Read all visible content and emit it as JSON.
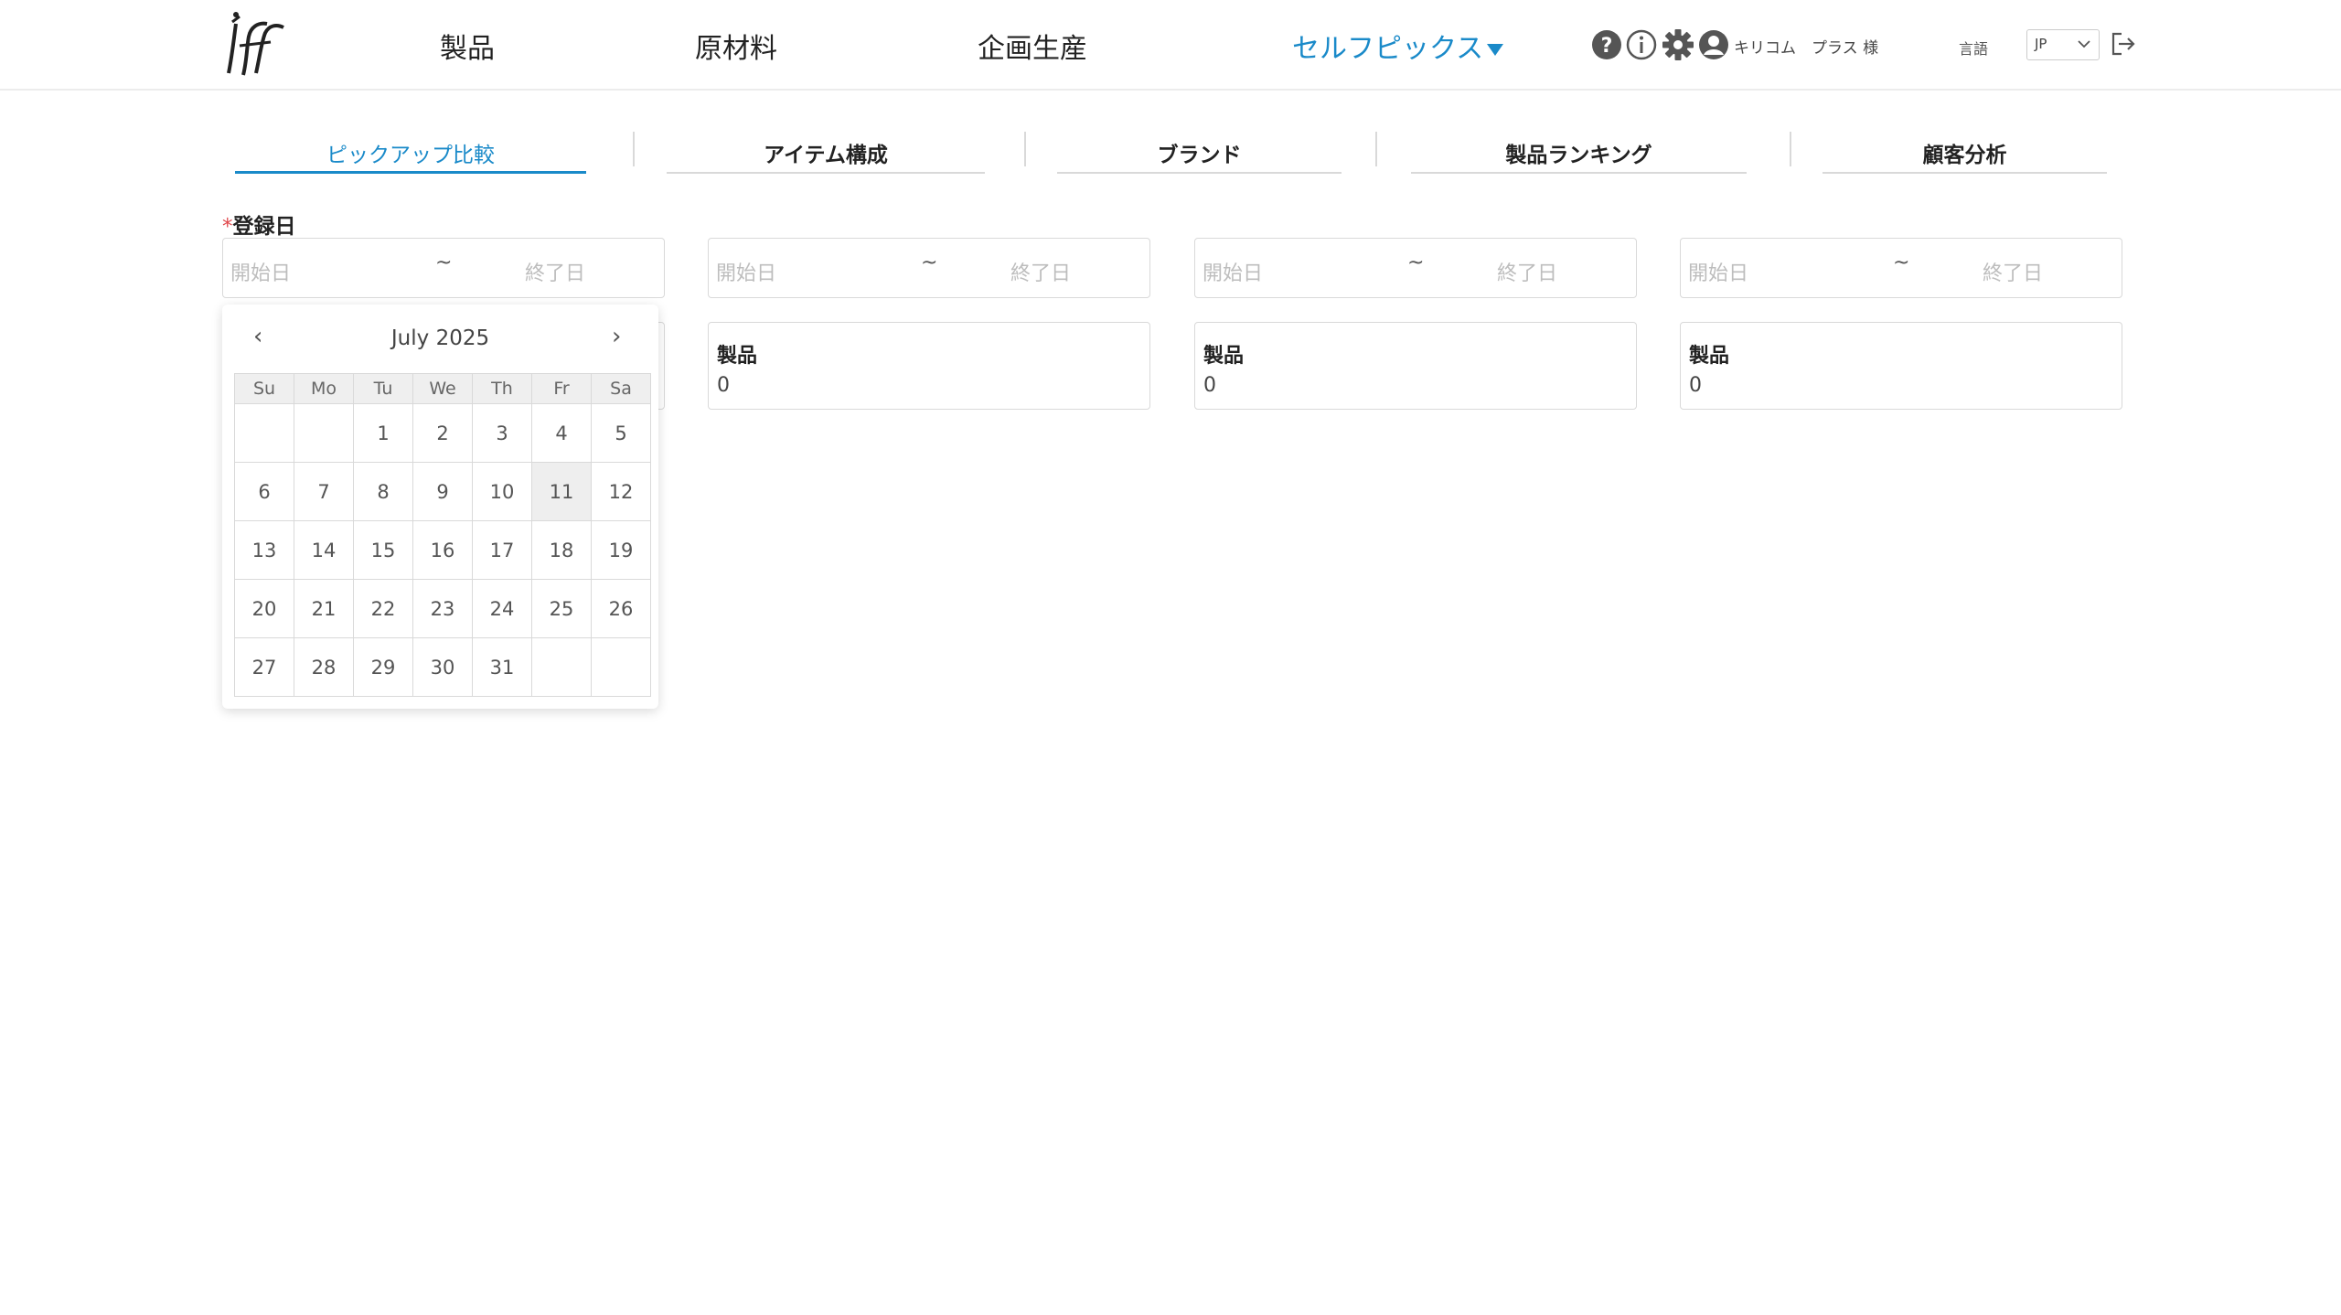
{
  "header": {
    "nav": [
      "製品",
      "原材料",
      "企画生産",
      "セルフピックス"
    ],
    "active_nav": "セルフピックス",
    "user_name": "キリコム　プラス 様",
    "lang_label": "言語",
    "lang_value": "JP"
  },
  "tabs": [
    "ピックアップ比較",
    "アイテム構成",
    "ブランド",
    "製品ランキング",
    "顧客分析"
  ],
  "active_tab": "ピックアップ比較",
  "form": {
    "required_mark": "*",
    "date_label": "登録日",
    "start_placeholder": "開始日",
    "end_placeholder": "終了日",
    "tilde": "~"
  },
  "cards": [
    {
      "title": "製品",
      "value": "0"
    },
    {
      "title": "製品",
      "value": "0"
    },
    {
      "title": "製品",
      "value": "0"
    }
  ],
  "calendar": {
    "title": "July 2025",
    "prev": "‹",
    "next": "›",
    "weekdays": [
      "Su",
      "Mo",
      "Tu",
      "We",
      "Th",
      "Fr",
      "Sa"
    ],
    "weeks": [
      [
        "",
        "",
        "1",
        "2",
        "3",
        "4",
        "5"
      ],
      [
        "6",
        "7",
        "8",
        "9",
        "10",
        "11",
        "12"
      ],
      [
        "13",
        "14",
        "15",
        "16",
        "17",
        "18",
        "19"
      ],
      [
        "20",
        "21",
        "22",
        "23",
        "24",
        "25",
        "26"
      ],
      [
        "27",
        "28",
        "29",
        "30",
        "31",
        "",
        ""
      ]
    ],
    "highlighted_day": "11"
  },
  "colors": {
    "accent": "#1a8ac9",
    "required": "#e0484c",
    "border": "#d9d9d9",
    "placeholder": "#bdbdbd"
  },
  "icons": [
    "brand-logo",
    "help-icon",
    "info-icon",
    "gear-icon",
    "user-icon",
    "chevron-down-icon",
    "logout-icon",
    "chevron-left-icon",
    "chevron-right-icon"
  ]
}
